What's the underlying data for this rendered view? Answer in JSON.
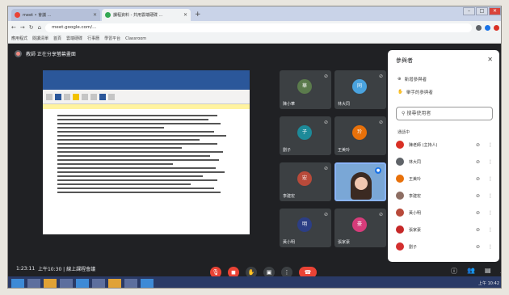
{
  "browser": {
    "tabs": [
      {
        "title": "meet • 會議 ...",
        "color": "#ea4335",
        "active": false
      },
      {
        "title": "課程資料 - 共用雲端硬碟 ...",
        "color": "#34a853",
        "active": true
      }
    ],
    "url": "meet.google.com/...",
    "bookmarks": [
      "應用程式",
      "閱讀清單",
      "首頁",
      "雲端硬碟",
      "行事曆",
      "學習平台",
      "Classroom"
    ]
  },
  "meet": {
    "presenter": "教師 正在分享螢幕畫面",
    "tiles": [
      {
        "name": "陳小華",
        "color": "#5b7b4c",
        "initial": "華"
      },
      {
        "name": "林大同",
        "color": "#4aa3df",
        "initial": "同"
      },
      {
        "name": "劉子",
        "color": "#1d8a99",
        "initial": "子"
      },
      {
        "name": "王美玲",
        "color": "#e8710a",
        "initial": "玲"
      },
      {
        "name": "李建宏",
        "color": "#b84a3a",
        "initial": "宏"
      },
      {
        "name": "",
        "color": "#7aa7d6",
        "initial": ""
      },
      {
        "name": "黃小明",
        "color": "#2c3e85",
        "initial": "明"
      },
      {
        "name": "張家豪",
        "color": "#d63c7a",
        "initial": "豪"
      }
    ],
    "meeting_info": "上午10:30  |  線上課程會議",
    "time": "1:23:11"
  },
  "panel": {
    "title": "參與者",
    "close": "✕",
    "add_people": "新增參與者",
    "raise": "舉手的參與者",
    "search_placeholder": "搜尋使用者",
    "in_call": "通話中",
    "people": [
      {
        "name": "陳老師 (主持人)",
        "color": "#d93025"
      },
      {
        "name": "林大同",
        "color": "#5f6368"
      },
      {
        "name": "王美玲",
        "color": "#e8710a"
      },
      {
        "name": "李建宏",
        "color": "#8d6e63"
      },
      {
        "name": "黃小明",
        "color": "#b84a3a"
      },
      {
        "name": "張家豪",
        "color": "#c62828"
      },
      {
        "name": "劉子",
        "color": "#d32f2f"
      }
    ]
  },
  "taskbar": {
    "clock": "上午 10:42"
  }
}
